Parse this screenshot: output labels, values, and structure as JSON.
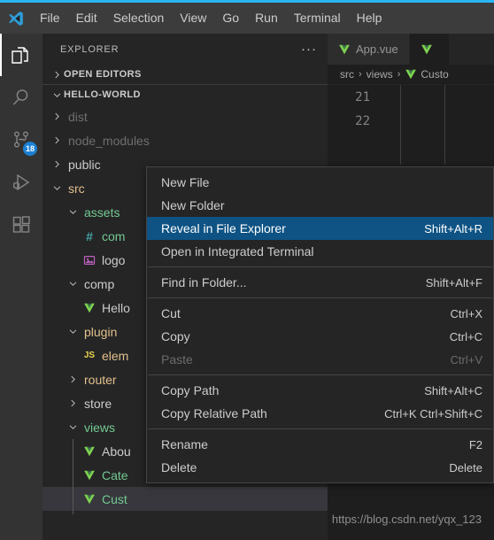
{
  "window": {
    "accent_strip_color": "#29b6f6",
    "titlebar_bg": "#3c3c3c",
    "logo_name": "vscode-logo"
  },
  "menubar": {
    "items": [
      {
        "label": "File"
      },
      {
        "label": "Edit"
      },
      {
        "label": "Selection"
      },
      {
        "label": "View"
      },
      {
        "label": "Go"
      },
      {
        "label": "Run"
      },
      {
        "label": "Terminal"
      },
      {
        "label": "Help"
      }
    ]
  },
  "activitybar": {
    "items": [
      {
        "name": "explorer-icon",
        "active": true,
        "badge": ""
      },
      {
        "name": "search-icon",
        "active": false,
        "badge": ""
      },
      {
        "name": "source-control-icon",
        "active": false,
        "badge": "18"
      },
      {
        "name": "run-and-debug-icon",
        "active": false,
        "badge": ""
      },
      {
        "name": "extensions-icon",
        "active": false,
        "badge": ""
      }
    ],
    "badge_color": "#1b80d4"
  },
  "sidebar": {
    "title": "EXPLORER",
    "more_actions": "···",
    "sections": [
      {
        "label": "OPEN EDITORS",
        "expanded": false
      },
      {
        "label": "HELLO-WORLD",
        "expanded": true
      }
    ],
    "tree": [
      {
        "label": "dist",
        "depth": 1,
        "kind": "folder",
        "expanded": false,
        "color": "dim"
      },
      {
        "label": "node_modules",
        "depth": 1,
        "kind": "folder",
        "expanded": false,
        "color": "dim"
      },
      {
        "label": "public",
        "depth": 1,
        "kind": "folder",
        "expanded": false,
        "color": "norm"
      },
      {
        "label": "src",
        "depth": 1,
        "kind": "folder",
        "expanded": true,
        "color": "mod"
      },
      {
        "label": "assets",
        "depth": 2,
        "kind": "folder",
        "expanded": true,
        "color": "add"
      },
      {
        "label": "com",
        "depth": 3,
        "kind": "css",
        "expanded": false,
        "color": "add"
      },
      {
        "label": "logo",
        "depth": 3,
        "kind": "image",
        "expanded": false,
        "color": "norm"
      },
      {
        "label": "comp",
        "depth": 2,
        "kind": "folder",
        "expanded": true,
        "color": "norm"
      },
      {
        "label": "Hello",
        "depth": 3,
        "kind": "vue",
        "expanded": false,
        "color": "norm"
      },
      {
        "label": "plugin",
        "depth": 2,
        "kind": "folder",
        "expanded": true,
        "color": "mod"
      },
      {
        "label": "elem",
        "depth": 3,
        "kind": "js",
        "expanded": false,
        "color": "mod"
      },
      {
        "label": "router",
        "depth": 2,
        "kind": "folder",
        "expanded": false,
        "color": "mod"
      },
      {
        "label": "store",
        "depth": 2,
        "kind": "folder",
        "expanded": false,
        "color": "norm"
      },
      {
        "label": "views",
        "depth": 2,
        "kind": "folder",
        "expanded": true,
        "color": "add"
      },
      {
        "label": "Abou",
        "depth": 3,
        "kind": "vue",
        "expanded": false,
        "color": "norm"
      },
      {
        "label": "Cate",
        "depth": 3,
        "kind": "vue",
        "expanded": false,
        "color": "add"
      },
      {
        "label": "Cust",
        "depth": 3,
        "kind": "vue",
        "expanded": false,
        "color": "add",
        "selected": true
      }
    ]
  },
  "editor": {
    "tabs": [
      {
        "label": "App.vue",
        "icon": "vue-icon",
        "active": false
      },
      {
        "label": "",
        "icon": "vue-icon",
        "active": true
      }
    ],
    "breadcrumb": [
      {
        "label": "src",
        "icon": ""
      },
      {
        "label": "views",
        "icon": ""
      },
      {
        "label": "Custo",
        "icon": "vue-icon"
      }
    ],
    "breadcrumb_separator": "›",
    "line_numbers": [
      "21",
      "22"
    ]
  },
  "context_menu": {
    "items": [
      {
        "label": "New File",
        "shortcut": "",
        "state": "normal"
      },
      {
        "label": "New Folder",
        "shortcut": "",
        "state": "normal"
      },
      {
        "label": "Reveal in File Explorer",
        "shortcut": "Shift+Alt+R",
        "state": "highlight"
      },
      {
        "label": "Open in Integrated Terminal",
        "shortcut": "",
        "state": "normal"
      },
      {
        "type": "separator"
      },
      {
        "label": "Find in Folder...",
        "shortcut": "Shift+Alt+F",
        "state": "normal"
      },
      {
        "type": "separator"
      },
      {
        "label": "Cut",
        "shortcut": "Ctrl+X",
        "state": "normal"
      },
      {
        "label": "Copy",
        "shortcut": "Ctrl+C",
        "state": "normal"
      },
      {
        "label": "Paste",
        "shortcut": "Ctrl+V",
        "state": "disabled"
      },
      {
        "type": "separator"
      },
      {
        "label": "Copy Path",
        "shortcut": "Shift+Alt+C",
        "state": "normal"
      },
      {
        "label": "Copy Relative Path",
        "shortcut": "Ctrl+K Ctrl+Shift+C",
        "state": "normal"
      },
      {
        "type": "separator"
      },
      {
        "label": "Rename",
        "shortcut": "F2",
        "state": "normal"
      },
      {
        "label": "Delete",
        "shortcut": "Delete",
        "state": "normal"
      }
    ],
    "highlight_color": "#0e5384"
  },
  "watermark": {
    "text": "https://blog.csdn.net/yqx_123"
  }
}
